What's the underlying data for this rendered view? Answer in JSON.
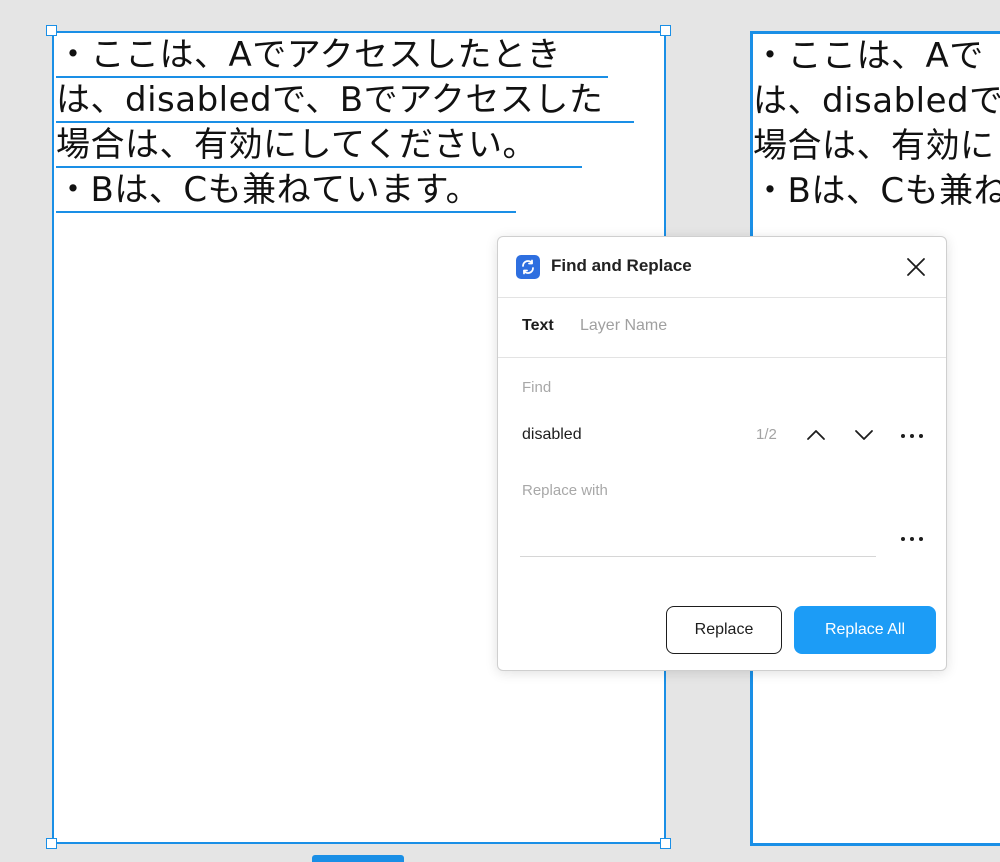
{
  "canvas": {
    "text_lines": [
      "・ここは、Aでアクセスしたとき",
      "は、disabledで、Bでアクセスした",
      "場合は、有効にしてください。",
      "・Bは、Cも兼ねています。"
    ],
    "right_text_lines": [
      "・ここは、Aで",
      "は、disabledで",
      "場合は、有効に",
      "・Bは、Cも兼ね"
    ]
  },
  "dialog": {
    "title": "Find and Replace",
    "tabs": [
      {
        "label": "Text"
      },
      {
        "label": "Layer Name"
      }
    ],
    "find": {
      "label": "Find",
      "value": "disabled",
      "match_count": "1/2"
    },
    "replace": {
      "label": "Replace with",
      "value": ""
    },
    "buttons": {
      "replace": "Replace",
      "replace_all": "Replace All"
    }
  },
  "colors": {
    "selection": "#1a8fe6",
    "primary_button": "#1c9cf6",
    "app_icon": "#2e6fe0"
  }
}
